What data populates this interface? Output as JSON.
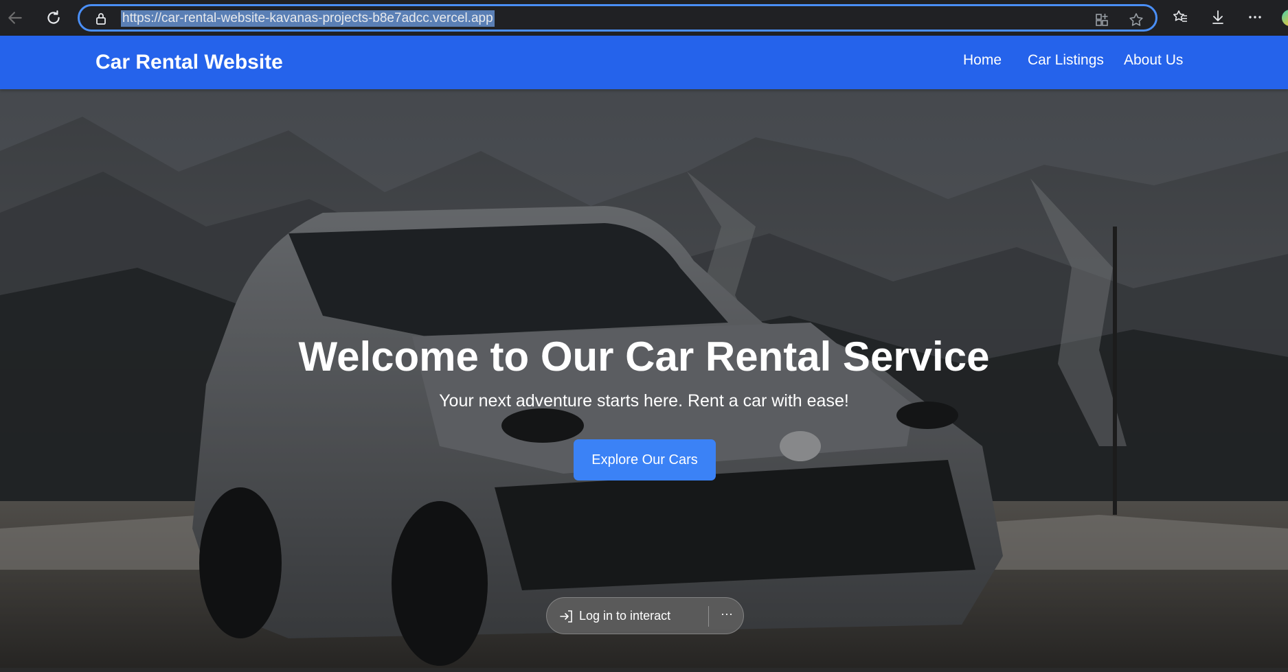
{
  "browser": {
    "url": "https://car-rental-website-kavanas-projects-b8e7adcc.vercel.app",
    "icons": [
      "back-arrow-icon",
      "refresh-icon",
      "lock-icon",
      "app-grid-icon",
      "star-icon",
      "favorites-icon",
      "download-icon",
      "more-icon"
    ]
  },
  "site": {
    "title": "Car Rental Website",
    "nav": [
      {
        "label": "Home"
      },
      {
        "label": "Car Listings"
      },
      {
        "label": "About Us"
      }
    ],
    "header_color": "#2563eb"
  },
  "hero": {
    "title": "Welcome to Our Car Rental Service",
    "subtitle": "Your next adventure starts here. Rent a car with ease!",
    "button_label": "Explore Our Cars",
    "button_color": "#3b82f6"
  },
  "overlay": {
    "login_label": "Log in to interact",
    "more_label": "···"
  }
}
